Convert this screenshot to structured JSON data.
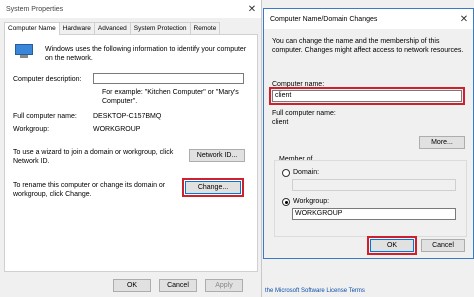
{
  "system_props": {
    "title": "System Properties",
    "tabs": [
      "Computer Name",
      "Hardware",
      "Advanced",
      "System Protection",
      "Remote"
    ],
    "intro": "Windows uses the following information to identify your computer on the network.",
    "desc_label": "Computer description:",
    "desc_value": "",
    "example_line1": "For example: \"Kitchen Computer\" or \"Mary's",
    "example_line2": "Computer\".",
    "full_name_label": "Full computer name:",
    "full_name_value": "DESKTOP-C157BMQ",
    "workgroup_label": "Workgroup:",
    "workgroup_value": "WORKGROUP",
    "wizard_text_1": "To use a wizard to join a domain or workgroup, click",
    "wizard_text_2": "Network ID.",
    "network_id_button": "Network ID...",
    "rename_text_1": "To rename this computer or change its domain or",
    "rename_text_2": "workgroup, click Change.",
    "change_button": "Change...",
    "ok_button": "OK",
    "cancel_button": "Cancel",
    "apply_button": "Apply"
  },
  "changes_dialog": {
    "title": "Computer Name/Domain Changes",
    "intro_1": "You can change the name and the membership of this",
    "intro_2": "computer. Changes might affect access to network resources.",
    "computer_name_label": "Computer name:",
    "computer_name_value": "client",
    "full_name_label": "Full computer name:",
    "full_name_value": "client",
    "more_button": "More...",
    "member_of_label": "Member of",
    "domain_label": "Domain:",
    "domain_value": "",
    "workgroup_label": "Workgroup:",
    "workgroup_value": "WORKGROUP",
    "ok_button": "OK",
    "cancel_button": "Cancel"
  },
  "background_link": "the Microsoft Software License Terms"
}
